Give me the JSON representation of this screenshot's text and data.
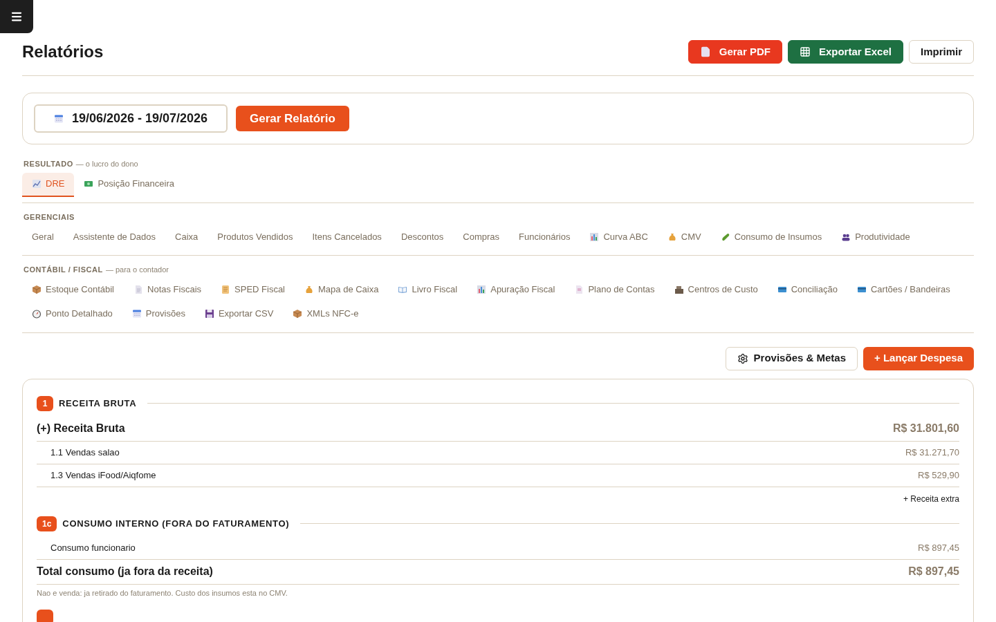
{
  "page": {
    "title": "Relatórios"
  },
  "header_actions": [
    {
      "kind": "pdf",
      "label": "Gerar PDF"
    },
    {
      "kind": "excel",
      "label": "Exportar Excel"
    },
    {
      "kind": "plain",
      "label": "Imprimir"
    }
  ],
  "filter": {
    "date_range": "19/06/2026 - 19/07/2026",
    "button": "Gerar Relatório"
  },
  "groups": [
    {
      "title": "RESULTADO",
      "subtitle": "— o lucro do dono",
      "tabs": [
        {
          "label": "DRE",
          "selected": true
        },
        {
          "label": "Posição Financeira",
          "selected": false
        }
      ]
    },
    {
      "title": "GERENCIAIS",
      "tabs": [
        {
          "label": "Geral",
          "selected": false
        },
        {
          "label": "Assistente de Dados",
          "selected": false
        },
        {
          "label": "Caixa",
          "selected": false
        },
        {
          "label": "Produtos Vendidos",
          "selected": false
        },
        {
          "label": "Itens Cancelados",
          "selected": false
        },
        {
          "label": "Descontos",
          "selected": false
        },
        {
          "label": "Compras",
          "selected": false
        },
        {
          "label": "Funcionários",
          "selected": false
        },
        {
          "label": "Curva ABC",
          "selected": false
        },
        {
          "label": "CMV",
          "selected": false
        },
        {
          "label": "Consumo de Insumos",
          "selected": false
        },
        {
          "label": "Produtividade",
          "selected": false
        }
      ]
    },
    {
      "title": "CONTÁBIL / FISCAL",
      "subtitle": "— para o contador",
      "tabs": [
        {
          "label": "Estoque Contábil",
          "selected": false
        },
        {
          "label": "Notas Fiscais",
          "selected": false
        },
        {
          "label": "SPED Fiscal",
          "selected": false
        },
        {
          "label": "Mapa de Caixa",
          "selected": false
        },
        {
          "label": "Livro Fiscal",
          "selected": false
        },
        {
          "label": "Apuração Fiscal",
          "selected": false
        },
        {
          "label": "Plano de Contas",
          "selected": false
        },
        {
          "label": "Centros de Custo",
          "selected": false
        },
        {
          "label": "Conciliação",
          "selected": false
        },
        {
          "label": "Cartões / Bandeiras",
          "selected": false
        },
        {
          "label": "Ponto Detalhado",
          "selected": false
        },
        {
          "label": "Provisões",
          "selected": false
        },
        {
          "label": "Exportar CSV",
          "selected": false
        },
        {
          "label": "XMLs NFC-e",
          "selected": false
        }
      ]
    }
  ],
  "report_actions": [
    {
      "kind": "settings",
      "label": "Provisões & Metas"
    },
    {
      "kind": "primary",
      "label": "+ Lançar Despesa"
    }
  ],
  "sections": [
    {
      "badge": "1",
      "title": "RECEITA BRUTA",
      "rows": [
        {
          "kind": "total",
          "label": "(+) Receita Bruta",
          "value": "R$ 31.801,60"
        },
        {
          "kind": "item",
          "label": "1.1 Vendas salao",
          "value": "R$ 31.271,70"
        },
        {
          "kind": "item",
          "label": "1.3 Vendas iFood/Aiqfome",
          "value": "R$ 529,90"
        },
        {
          "kind": "action",
          "label": "+ Receita extra"
        }
      ]
    },
    {
      "badge": "1c",
      "title": "CONSUMO INTERNO (FORA DO FATURAMENTO)",
      "rows": [
        {
          "kind": "item",
          "label": "Consumo funcionario",
          "value": "R$ 897,45"
        },
        {
          "kind": "total",
          "label": "Total consumo (ja fora da receita)",
          "value": "R$ 897,45"
        },
        {
          "kind": "note",
          "label": "Nao e venda: ja retirado do faturamento. Custo dos insumos esta no CMV."
        }
      ]
    }
  ]
}
